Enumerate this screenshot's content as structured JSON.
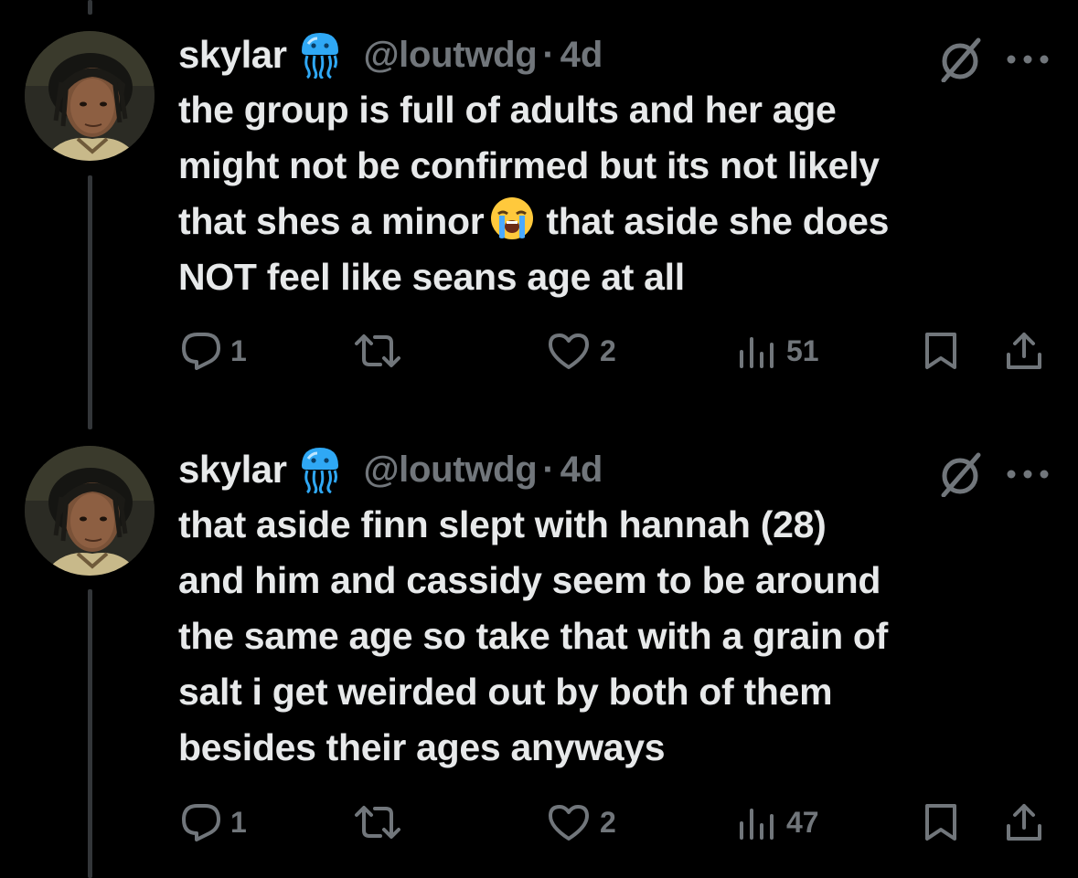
{
  "tweets": [
    {
      "name": "skylar",
      "badge_icon": "jellyfish-emoji",
      "handle": "@loutwdg",
      "separator": "·",
      "time": "4d",
      "text_lines": [
        "the group is full of adults and her age",
        "might not be confirmed but its not likely",
        "that shes a minor",
        "that aside she does",
        "NOT feel like seans age at all"
      ],
      "inline_emoji": "loudly-crying-face-emoji",
      "replies": "1",
      "reposts": "",
      "likes": "2",
      "views": "51"
    },
    {
      "name": "skylar",
      "badge_icon": "jellyfish-emoji",
      "handle": "@loutwdg",
      "separator": "·",
      "time": "4d",
      "text_lines": [
        "that aside finn slept with hannah (28)",
        "and him and cassidy seem to be around",
        "the same age so take that with a grain of",
        "salt i get weirded out by both of them",
        "besides their ages anyways"
      ],
      "replies": "1",
      "reposts": "",
      "likes": "2",
      "views": "47"
    }
  ],
  "colors": {
    "background": "#000000",
    "text": "#e7e9ea",
    "secondary": "#71767b",
    "thread_line": "#333639",
    "jellyfish": "#1d9bf0"
  }
}
